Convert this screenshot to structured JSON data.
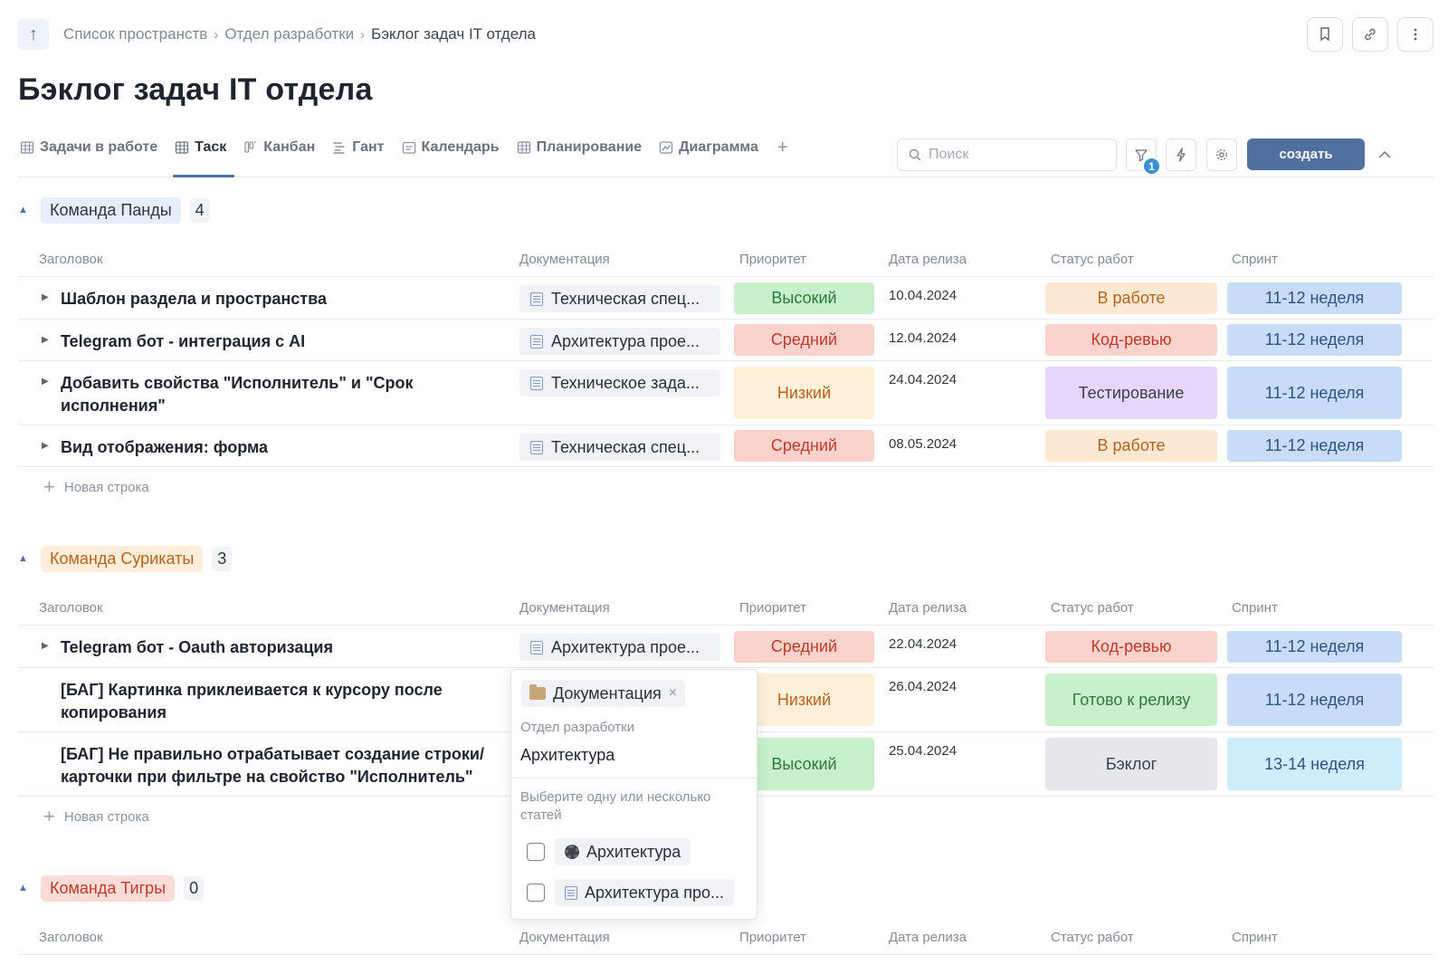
{
  "breadcrumb": [
    "Список пространств",
    "Отдел разработки",
    "Бэклог задач IT отдела"
  ],
  "page_title": "Бэклог задач IT отдела",
  "tabs": [
    {
      "label": "Задачи в работе",
      "icon": "table-icon"
    },
    {
      "label": "Таск",
      "icon": "table-icon",
      "active": true
    },
    {
      "label": "Канбан",
      "icon": "kanban-icon"
    },
    {
      "label": "Гант",
      "icon": "gantt-icon"
    },
    {
      "label": "Календарь",
      "icon": "calendar-icon"
    },
    {
      "label": "Планирование",
      "icon": "table-icon"
    },
    {
      "label": "Диаграмма",
      "icon": "chart-icon"
    }
  ],
  "add_tab_label": "+",
  "search": {
    "placeholder": "Поиск"
  },
  "filter_badge": "1",
  "create_label": "создать",
  "columns": [
    "Заголовок",
    "Документация",
    "Приоритет",
    "Дата релиза",
    "Статус работ",
    "Спринт"
  ],
  "new_row_label": "Новая строка",
  "groups": [
    {
      "name": "Команда Панды",
      "count": "4",
      "rows": [
        {
          "title": "Шаблон раздела и пространства",
          "doc": "Техническая спец...",
          "priority": "Высокий",
          "date": "10.04.2024",
          "status": "В работе",
          "sprint": "11-12 неделя"
        },
        {
          "title": "Telegram бот - интеграция с AI",
          "doc": "Архитектура прое...",
          "priority": "Средний",
          "date": "12.04.2024",
          "status": "Код-ревью",
          "sprint": "11-12 неделя"
        },
        {
          "title": "Добавить свойства \"Исполнитель\" и \"Срок исполнения\"",
          "doc": "Техническое зада...",
          "priority": "Низкий",
          "date": "24.04.2024",
          "status": "Тестирование",
          "sprint": "11-12 неделя"
        },
        {
          "title": "Вид отображения: форма",
          "doc": "Техническая спец...",
          "priority": "Средний",
          "date": "08.05.2024",
          "status": "В работе",
          "sprint": "11-12 неделя"
        }
      ]
    },
    {
      "name": "Команда Сурикаты",
      "count": "3",
      "rows": [
        {
          "title": "Telegram бот - Oauth авторизация",
          "doc": "Архитектура прое...",
          "priority": "Средний",
          "date": "22.04.2024",
          "status": "Код-ревью",
          "sprint": "11-12 неделя"
        },
        {
          "title": "[БАГ] Картинка приклеивается к курсору после копирования",
          "doc": "",
          "priority": "Низкий",
          "date": "26.04.2024",
          "status": "Готово к релизу",
          "sprint": "11-12 неделя"
        },
        {
          "title": "[БАГ] Не правильно отрабатывает создание строки/карточки при фильтре на свойство \"Исполнитель\"",
          "doc": "",
          "priority": "Высокий",
          "date": "25.04.2024",
          "status": "Бэклог",
          "sprint": "13-14 неделя"
        }
      ]
    },
    {
      "name": "Команда Тигры",
      "count": "0",
      "rows": []
    }
  ],
  "dropdown": {
    "selected_tag": "Документация",
    "section": "Отдел разработки",
    "input_value": "Архитектура",
    "hint": "Выберите одну или несколько статей",
    "options": [
      {
        "label": "Архитектура",
        "icon": "gear-icon"
      },
      {
        "label": "Архитектура про...",
        "icon": "document-icon"
      }
    ]
  },
  "colors": {
    "accent": "#50709f",
    "priority_high": "#c9f0cc",
    "priority_medium": "#fbd3cc",
    "priority_low": "#fdf0d9",
    "status_in_work": "#fde9d3",
    "status_review": "#fbd3cc",
    "status_testing": "#e6d6fb",
    "status_ready": "#c9f0cc",
    "status_backlog": "#e6e7ea",
    "sprint_11_12": "#c8dcf7",
    "sprint_13_14": "#cdeefb"
  }
}
